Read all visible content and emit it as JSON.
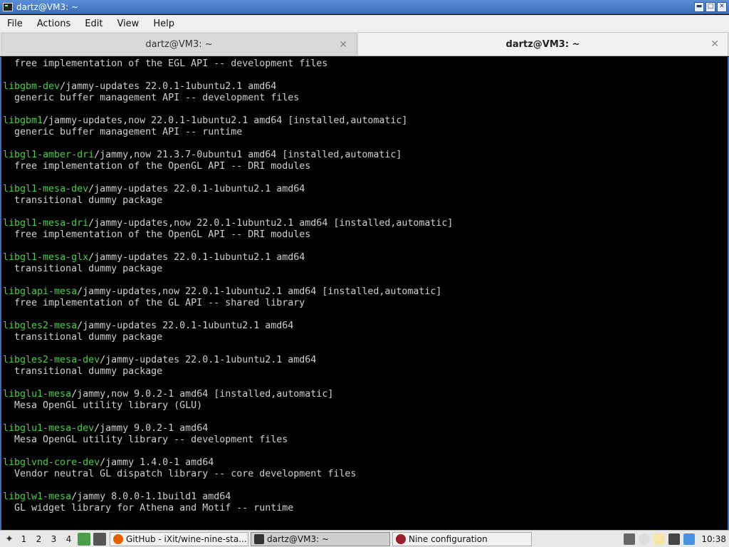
{
  "window": {
    "title": "dartz@VM3: ~"
  },
  "menu": [
    "File",
    "Actions",
    "Edit",
    "View",
    "Help"
  ],
  "tabs": [
    {
      "label": "dartz@VM3: ~",
      "active": false
    },
    {
      "label": "dartz@VM3: ~",
      "active": true
    }
  ],
  "terminal": {
    "lines": [
      {
        "pkg": "",
        "rest": "  free implementation of the EGL API -- development files"
      },
      {
        "pkg": "",
        "rest": ""
      },
      {
        "pkg": "libgbm-dev",
        "rest": "/jammy-updates 22.0.1-1ubuntu2.1 amd64"
      },
      {
        "pkg": "",
        "rest": "  generic buffer management API -- development files"
      },
      {
        "pkg": "",
        "rest": ""
      },
      {
        "pkg": "libgbm1",
        "rest": "/jammy-updates,now 22.0.1-1ubuntu2.1 amd64 [installed,automatic]"
      },
      {
        "pkg": "",
        "rest": "  generic buffer management API -- runtime"
      },
      {
        "pkg": "",
        "rest": ""
      },
      {
        "pkg": "libgl1-amber-dri",
        "rest": "/jammy,now 21.3.7-0ubuntu1 amd64 [installed,automatic]"
      },
      {
        "pkg": "",
        "rest": "  free implementation of the OpenGL API -- DRI modules"
      },
      {
        "pkg": "",
        "rest": ""
      },
      {
        "pkg": "libgl1-mesa-dev",
        "rest": "/jammy-updates 22.0.1-1ubuntu2.1 amd64"
      },
      {
        "pkg": "",
        "rest": "  transitional dummy package"
      },
      {
        "pkg": "",
        "rest": ""
      },
      {
        "pkg": "libgl1-mesa-dri",
        "rest": "/jammy-updates,now 22.0.1-1ubuntu2.1 amd64 [installed,automatic]"
      },
      {
        "pkg": "",
        "rest": "  free implementation of the OpenGL API -- DRI modules"
      },
      {
        "pkg": "",
        "rest": ""
      },
      {
        "pkg": "libgl1-mesa-glx",
        "rest": "/jammy-updates 22.0.1-1ubuntu2.1 amd64"
      },
      {
        "pkg": "",
        "rest": "  transitional dummy package"
      },
      {
        "pkg": "",
        "rest": ""
      },
      {
        "pkg": "libglapi-mesa",
        "rest": "/jammy-updates,now 22.0.1-1ubuntu2.1 amd64 [installed,automatic]"
      },
      {
        "pkg": "",
        "rest": "  free implementation of the GL API -- shared library"
      },
      {
        "pkg": "",
        "rest": ""
      },
      {
        "pkg": "libgles2-mesa",
        "rest": "/jammy-updates 22.0.1-1ubuntu2.1 amd64"
      },
      {
        "pkg": "",
        "rest": "  transitional dummy package"
      },
      {
        "pkg": "",
        "rest": ""
      },
      {
        "pkg": "libgles2-mesa-dev",
        "rest": "/jammy-updates 22.0.1-1ubuntu2.1 amd64"
      },
      {
        "pkg": "",
        "rest": "  transitional dummy package"
      },
      {
        "pkg": "",
        "rest": ""
      },
      {
        "pkg": "libglu1-mesa",
        "rest": "/jammy,now 9.0.2-1 amd64 [installed,automatic]"
      },
      {
        "pkg": "",
        "rest": "  Mesa OpenGL utility library (GLU)"
      },
      {
        "pkg": "",
        "rest": ""
      },
      {
        "pkg": "libglu1-mesa-dev",
        "rest": "/jammy 9.0.2-1 amd64"
      },
      {
        "pkg": "",
        "rest": "  Mesa OpenGL utility library -- development files"
      },
      {
        "pkg": "",
        "rest": ""
      },
      {
        "pkg": "libglvnd-core-dev",
        "rest": "/jammy 1.4.0-1 amd64"
      },
      {
        "pkg": "",
        "rest": "  Vendor neutral GL dispatch library -- core development files"
      },
      {
        "pkg": "",
        "rest": ""
      },
      {
        "pkg": "libglw1-mesa",
        "rest": "/jammy 8.0.0-1.1build1 amd64"
      },
      {
        "pkg": "",
        "rest": "  GL widget library for Athena and Motif -- runtime"
      }
    ]
  },
  "taskbar": {
    "workspaces": [
      "1",
      "2",
      "3",
      "4"
    ],
    "tasks": [
      {
        "label": "GitHub - iXit/wine-nine-sta...",
        "icon": "firefox-icon",
        "active": false
      },
      {
        "label": "dartz@VM3: ~",
        "icon": "terminal-icon",
        "active": true
      },
      {
        "label": "Nine configuration",
        "icon": "wine-icon",
        "active": false
      }
    ],
    "clock": "10:38"
  },
  "colors": {
    "titlebar": "#3d6fb8",
    "terminal_bg": "#000000",
    "terminal_fg": "#d0d0d0",
    "package_name": "#4ec94e"
  }
}
